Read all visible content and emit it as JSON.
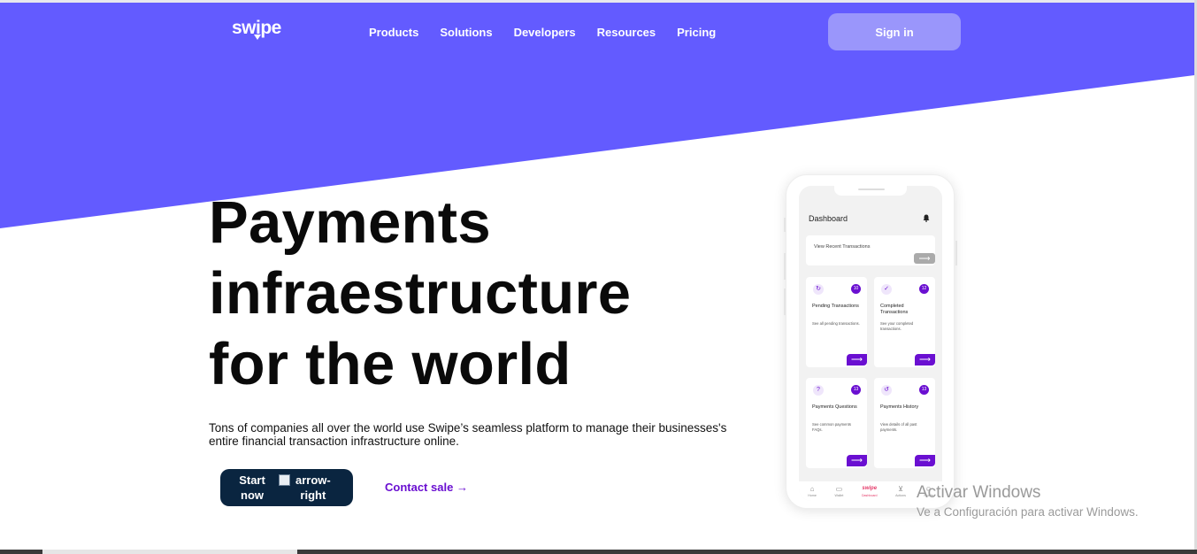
{
  "brand": {
    "logo_text": "swipe"
  },
  "colors": {
    "accent": "#635bff",
    "cta_dark": "#0a2540",
    "link": "#6a0fd1",
    "signin_bg": "#9a96fb"
  },
  "nav": {
    "items": [
      "Products",
      "Solutions",
      "Developers",
      "Resources",
      "Pricing"
    ]
  },
  "header": {
    "signin_label": "Sign in"
  },
  "hero": {
    "title_lines": [
      "Payments",
      "infraestructure",
      "for the world"
    ],
    "subtitle": "Tons of companies all over the world use Swipe’s seamless platform to manage their businesses's entire financial transaction infrastructure online.",
    "start_label_1": "Start",
    "start_label_2": "now",
    "broken_img_alt_1": "arrow-",
    "broken_img_alt_2": "right",
    "contact_label": "Contact sale",
    "contact_arrow": "→"
  },
  "phone": {
    "title": "Dashboard",
    "recent_label": "View Recent Transactions",
    "cards": [
      {
        "title": "Pending Transactions",
        "desc": "See all pending transactions.",
        "count": "10",
        "icon": "refresh-icon"
      },
      {
        "title": "Completed Transactions",
        "desc": "See your completed transactions.",
        "count": "12",
        "icon": "check-icon"
      },
      {
        "title": "Payments Questions",
        "desc": "See common payments FAQs.",
        "count": "13",
        "icon": "question-icon"
      },
      {
        "title": "Payments History",
        "desc": "View details of all past payments.",
        "count": "13",
        "icon": "history-icon"
      }
    ],
    "tabs": [
      "Home",
      "Wallet",
      "Dashboard",
      "Actions",
      "Profile"
    ]
  },
  "watermark": {
    "line1": "Activar Windows",
    "line2": "Ve a Configuración para activar Windows."
  }
}
